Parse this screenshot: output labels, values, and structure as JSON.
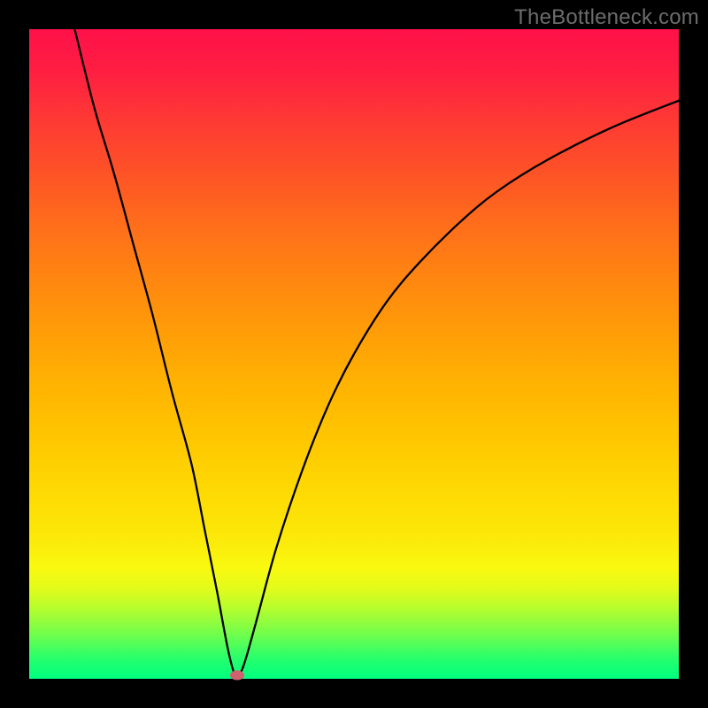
{
  "watermark": "TheBottleneck.com",
  "colors": {
    "frame": "#000000",
    "curve": "#000000",
    "marker": "#cf6170",
    "gradient_top": "#fe1149",
    "gradient_bottom": "#00ff7f"
  },
  "chart_data": {
    "type": "line",
    "title": "",
    "xlabel": "",
    "ylabel": "",
    "xlim": [
      0,
      100
    ],
    "ylim": [
      0,
      100
    ],
    "x": [
      7,
      10,
      13,
      16,
      19,
      22,
      25,
      27,
      29,
      30.5,
      31.5,
      32,
      33,
      35,
      38,
      42,
      46,
      50,
      55,
      60,
      66,
      72,
      80,
      90,
      100
    ],
    "values": [
      100,
      88,
      78,
      67,
      56,
      44,
      33,
      23,
      13,
      5,
      1,
      0.5,
      2,
      9,
      20,
      32,
      42,
      50,
      58,
      64,
      70,
      75,
      80,
      85,
      89
    ],
    "marker": {
      "x": 32,
      "y": 0.5
    },
    "notes": "V-shaped bottleneck curve. y is mismatch percentage (higher = worse, red zone; lower = better, green zone). Minimum around x≈32."
  }
}
